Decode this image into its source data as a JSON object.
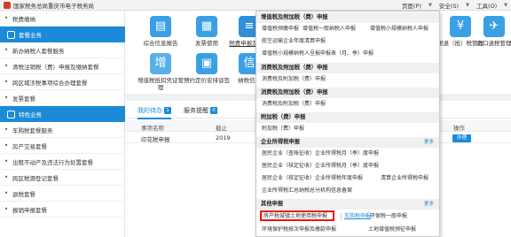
{
  "window": {
    "title": "国家税务总局重庆市电子税务局",
    "controls": [
      "页面(P)",
      "安全(S)",
      "工具(O)"
    ]
  },
  "sidebar": {
    "items": [
      {
        "label": "税费缴纳",
        "kind": "sub"
      },
      {
        "label": "套餐业务",
        "kind": "category"
      },
      {
        "label": "新办纳税人套餐服务",
        "kind": "sub"
      },
      {
        "label": "清税注销税（费）申报及缴纳套餐",
        "kind": "sub"
      },
      {
        "label": "跨区域涉税事项综合办理套餐",
        "kind": "sub"
      },
      {
        "label": "发票套餐",
        "kind": "sub"
      },
      {
        "label": "特色业务",
        "kind": "category"
      },
      {
        "label": "车购税套餐服务",
        "kind": "sub"
      },
      {
        "label": "房产交易套餐",
        "kind": "sub"
      },
      {
        "label": "出租不动产及违法行为处置套餐",
        "kind": "sub"
      },
      {
        "label": "跨区税源登记套餐",
        "kind": "sub"
      },
      {
        "label": "退税套餐",
        "kind": "sub"
      },
      {
        "label": "报销申报套餐",
        "kind": "sub"
      }
    ]
  },
  "tiles": [
    {
      "label": "综合信息报告",
      "icon": "report-icon",
      "glyph": "▤"
    },
    {
      "label": "发票使用",
      "icon": "invoice-icon",
      "glyph": "▦"
    },
    {
      "label": "税费申报及缴纳",
      "icon": "declare-icon",
      "glyph": "≡"
    },
    {
      "label": "增值税抵扣凭证管理",
      "icon": "voucher-icon",
      "glyph": "增"
    },
    {
      "label": "预约定价安排谈签",
      "icon": "appointment-icon",
      "glyph": "▣"
    },
    {
      "label": "纳税信用",
      "icon": "credit-icon",
      "glyph": "信"
    },
    {
      "label": "税退（抵）税管理",
      "icon": "refund-icon",
      "glyph": "¥"
    },
    {
      "label": "出口退税管理",
      "icon": "export-icon",
      "glyph": "✈"
    }
  ],
  "tabs": [
    {
      "label": "我的待办",
      "badge": "1"
    },
    {
      "label": "服务提醒",
      "badge": "0"
    }
  ],
  "table": {
    "headers": [
      "事项名称",
      "截止",
      "操作"
    ],
    "rows": [
      {
        "name": "印花税申报",
        "deadline": "2019",
        "action": "办理"
      }
    ]
  },
  "dropdown": {
    "sections": [
      {
        "title": "增值税及附加税（费）申报",
        "more": ""
      },
      {
        "title": "消费税及附加税（费）申报",
        "more": ""
      },
      {
        "title": "消费税及附加税（费）申报",
        "more": ""
      },
      {
        "title": "附加税（费）申报",
        "more": ""
      },
      {
        "title": "企业所得税申报",
        "more": "更多"
      },
      {
        "title": "其他申报",
        "more": "更多"
      }
    ],
    "vat_items": [
      "增值税预缴申报",
      "增值税一般纳税人申报",
      "增值税小规模纳税人申报",
      "航空运输企业年度清算申报",
      "增值税小规模纳税人呈报申报表（月、季）申报"
    ],
    "consumption_item": "消费税及附加税（费）申报",
    "consumption_item2": "消费税及附加税（费）申报",
    "surcharge_item": "附加税（费）申报",
    "cit_items": [
      "居民企业（查账征收）企业所得税月（季）度申报",
      "居民企业（核定征收）企业所得税月（季）度申报",
      "居民企业（核定征收）企业所得税年度申报",
      "清算企业所得税申报",
      "企业所得税汇总纳税总分机构信息备案"
    ],
    "other_items": [
      "房产税城镇土地使用税申报",
      "车购税申报",
      "环保税一般申报",
      "环境保护税按次申报及缴款申报",
      "土地增值税预征申报"
    ]
  }
}
